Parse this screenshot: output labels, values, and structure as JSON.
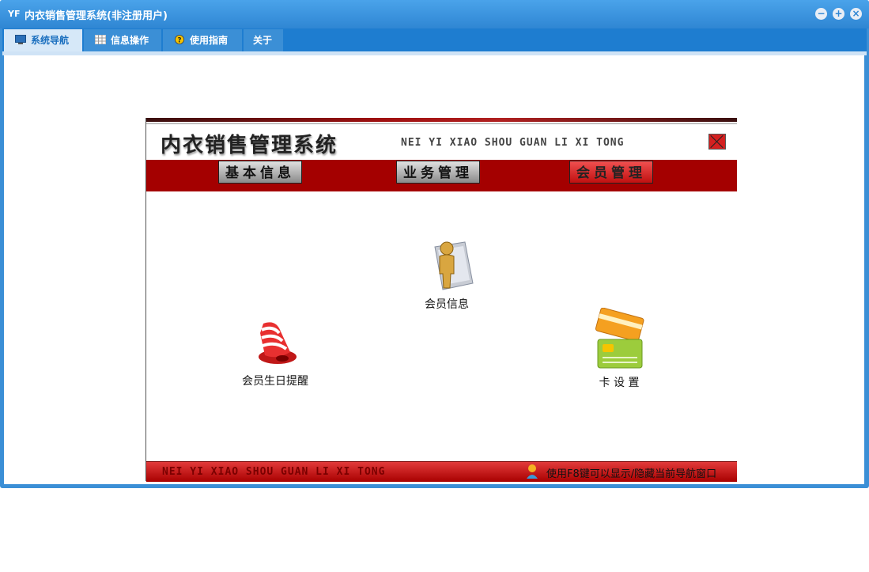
{
  "window": {
    "title": "内衣销售管理系统(非注册用户)",
    "app_icon": "YF"
  },
  "window_controls": {
    "minimize": "−",
    "restore": "+",
    "close": "×"
  },
  "menu": [
    {
      "label": "系统导航",
      "icon": "monitor-icon",
      "active": true
    },
    {
      "label": "信息操作",
      "icon": "grid-icon",
      "active": false
    },
    {
      "label": "使用指南",
      "icon": "help-icon",
      "active": false
    },
    {
      "label": "关于",
      "icon": "",
      "active": false
    }
  ],
  "panel": {
    "title": "内衣销售管理系统",
    "pinyin": "NEI YI XIAO SHOU GUAN LI XI TONG",
    "tabs": [
      "基本信息",
      "业务管理",
      "会员管理"
    ],
    "active_tab": "会员管理",
    "functions": [
      {
        "label": "会员信息",
        "icon": "member-person-icon"
      },
      {
        "label": "会员生日提醒",
        "icon": "bell-icon"
      },
      {
        "label": "卡 设 置",
        "icon": "card-icon"
      }
    ],
    "footer_pinyin": "NEI YI XIAO SHOU GUAN LI XI TONG",
    "footer_hint": "使用F8键可以显示/隐藏当前导航窗口"
  },
  "colors": {
    "title_bar": "#3b8fd6",
    "menu_bar": "#1e7dd0",
    "red_bar": "#a40000"
  }
}
